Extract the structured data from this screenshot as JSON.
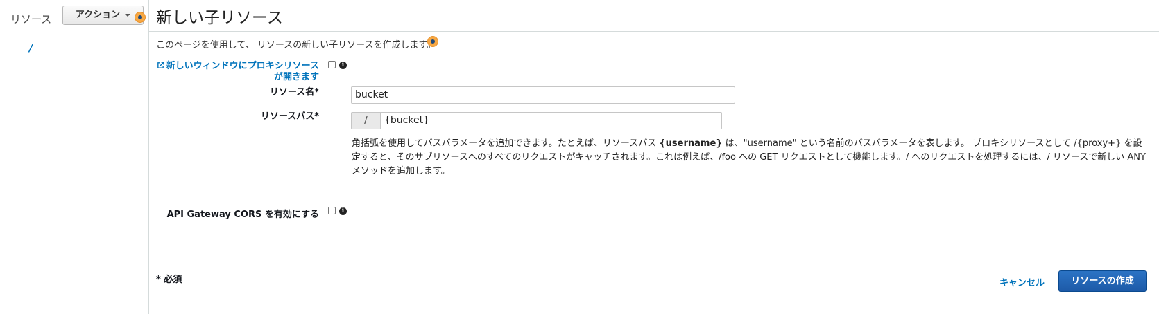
{
  "sidebar": {
    "title": "リソース",
    "actions_label": "アクション",
    "tree_root": "/"
  },
  "page": {
    "title": "新しい子リソース",
    "intro": "このページを使用して、 リソースの新しい子リソースを作成します。"
  },
  "form": {
    "proxy_link_label": "新しいウィンドウにプロキシリソースが開きます",
    "proxy_checked": false,
    "resource_name_label": "リソース名*",
    "resource_name_value": "bucket",
    "resource_path_label": "リソースパス*",
    "resource_path_prefix": "/",
    "resource_path_value": "{bucket}",
    "help_text": {
      "part1": "角括弧を使用してパスパラメータを追加できます。たとえば、リソースパス ",
      "bold": "{username}",
      "part2": " は、\"username\" という名前のパスパラメータを表します。 プロキシリソースとして /{proxy+} を設定すると、そのサブリソースへのすべてのリクエストがキャッチされます。これは例えば、/foo への GET リクエストとして機能します。/ へのリクエストを処理するには、/ リソースで新しい ANY メソッドを追加します。"
    },
    "cors_label": "API Gateway CORS を有効にする",
    "cors_checked": false
  },
  "footer": {
    "required_note": "* 必須",
    "cancel_label": "キャンセル",
    "create_label": "リソースの作成"
  },
  "icons": {
    "info": "info-icon",
    "external_link": "external-link-icon",
    "tour_marker": "tour-marker-icon"
  },
  "colors": {
    "link": "#0073bb",
    "primary_button": "#1d5aa8",
    "marker": "#f7a844"
  }
}
